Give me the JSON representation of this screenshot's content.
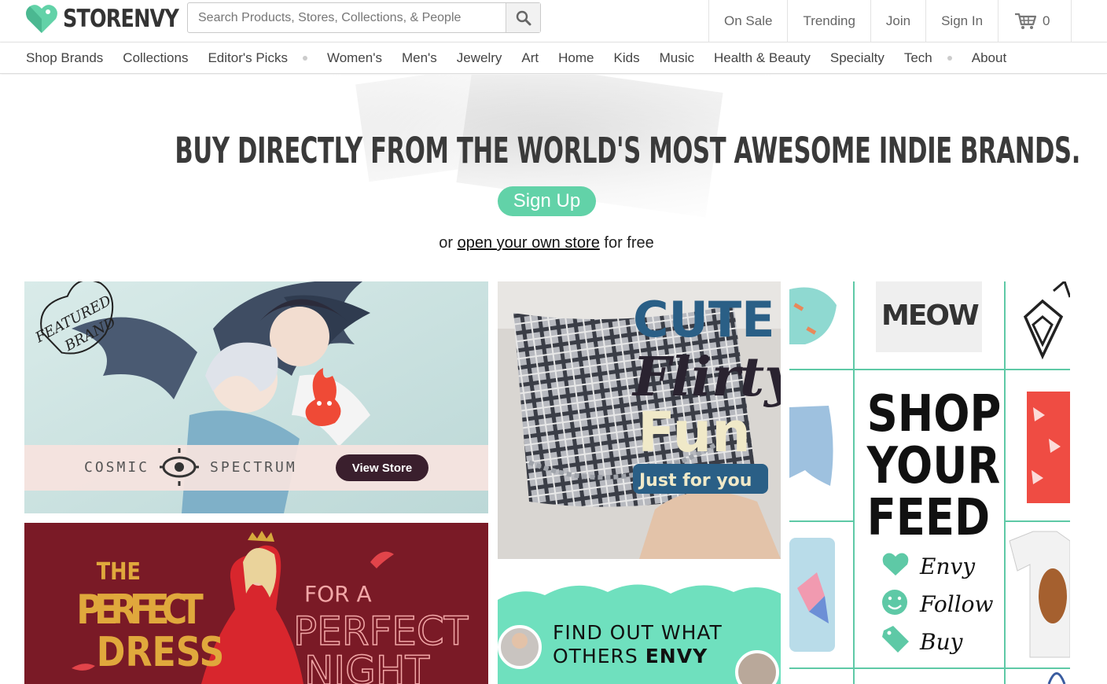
{
  "brand": {
    "name": "STORENVY",
    "accent": "#62d2a8"
  },
  "search": {
    "placeholder": "Search Products, Stores, Collections, & People",
    "icon": "search-icon"
  },
  "topnav": {
    "on_sale": "On Sale",
    "trending": "Trending",
    "join": "Join",
    "sign_in": "Sign In",
    "cart_count": "0",
    "cart_icon": "cart-icon"
  },
  "categories": [
    "Shop Brands",
    "Collections",
    "Editor's Picks",
    "Women's",
    "Men's",
    "Jewelry",
    "Art",
    "Home",
    "Kids",
    "Music",
    "Health & Beauty",
    "Specialty",
    "Tech",
    "About"
  ],
  "hero": {
    "headline": "BUY DIRECTLY FROM THE WORLD'S MOST AWESOME INDIE BRANDS.",
    "signup": "Sign Up",
    "sub_prefix": "or ",
    "sub_link": "open your own store",
    "sub_suffix": " for free"
  },
  "featured": {
    "badge_line1": "FEATURED",
    "badge_line2": "BRAND",
    "store_left": "COSMIC",
    "store_right": "SPECTRUM",
    "button": "View Store"
  },
  "dress": {
    "line1": "THE",
    "line2": "PERFECT",
    "line3": "DRESS",
    "line4": "FOR A",
    "line5": "PERFECT",
    "line6": "NIGHT"
  },
  "skirt": {
    "line1": "CUTE",
    "line2": "Flirty",
    "line3": "Fun",
    "line4": "Just for you"
  },
  "envy": {
    "line1": "FIND OUT WHAT",
    "line2_a": "OTHERS ",
    "line2_b": "ENVY"
  },
  "feed": {
    "meow": "MEOW",
    "title1": "SHOP",
    "title2": "YOUR",
    "title3": "FEED",
    "actions": [
      "Envy",
      "Follow",
      "Buy"
    ]
  }
}
